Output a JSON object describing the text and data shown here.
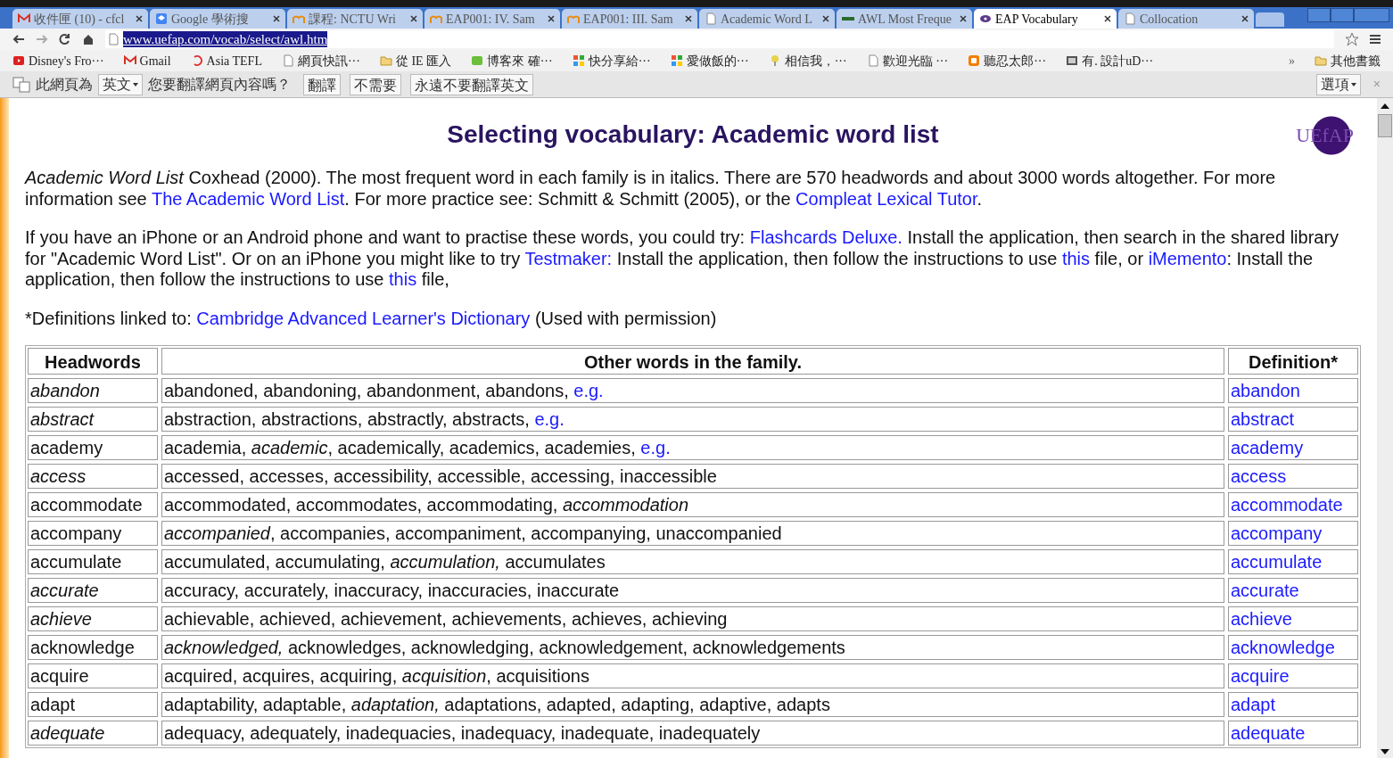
{
  "tabs": [
    {
      "title": "收件匣 (10) - cfcl",
      "kind": "gmail",
      "selected": false
    },
    {
      "title": "Google 學術搜",
      "kind": "scholar",
      "selected": false
    },
    {
      "title": "課程: NCTU Wri",
      "kind": "moodle",
      "selected": false
    },
    {
      "title": "EAP001: IV. Sam",
      "kind": "moodle",
      "selected": false
    },
    {
      "title": "EAP001: III. Sam",
      "kind": "moodle",
      "selected": false
    },
    {
      "title": "Academic Word L",
      "kind": "page",
      "selected": false
    },
    {
      "title": "AWL Most Freque",
      "kind": "dots",
      "selected": false
    },
    {
      "title": "EAP Vocabulary",
      "kind": "eye",
      "selected": true
    },
    {
      "title": "Collocation",
      "kind": "page",
      "selected": false
    }
  ],
  "address": "www.uefap.com/vocab/select/awl.htm",
  "bookmarks": [
    {
      "label": "Disney's Fro···",
      "kind": "video"
    },
    {
      "label": "Gmail",
      "kind": "gmail"
    },
    {
      "label": "Asia TEFL",
      "kind": "arc"
    },
    {
      "label": "網頁快訊···",
      "kind": "page"
    },
    {
      "label": "從 IE 匯入",
      "kind": "folder"
    },
    {
      "label": "博客來 確···",
      "kind": "message"
    },
    {
      "label": "快分享給···",
      "kind": "grid"
    },
    {
      "label": "愛做飯的···",
      "kind": "grid"
    },
    {
      "label": "相信我，···",
      "kind": "pin"
    },
    {
      "label": "歡迎光臨 ···",
      "kind": "page"
    },
    {
      "label": "聽忍太郎···",
      "kind": "blog"
    },
    {
      "label": "有. 設計uD···",
      "kind": "image"
    }
  ],
  "bookmarks_more": "»",
  "other_bookmarks": "其他書籤",
  "translate_bar": {
    "prefix": "此網頁為",
    "language": "英文",
    "question": "您要翻譯網頁內容嗎？",
    "buttons": [
      "翻譯",
      "不需要",
      "永遠不要翻譯英文"
    ],
    "options": "選項",
    "close": "×"
  },
  "page": {
    "title": "Selecting vocabulary: Academic word list",
    "logo": "UEfAP",
    "paragraphs": [
      [
        {
          "kind": "text",
          "text": "*Academic Word List* Coxhead (2000). The most frequent word in each family is in italics. There are 570 headwords and about 3000 words altogether. For more information see "
        },
        {
          "kind": "link",
          "text": "The Academic Word List"
        },
        {
          "kind": "text",
          "text": ". For more practice see: Schmitt & Schmitt (2005), or the "
        },
        {
          "kind": "link",
          "text": "Compleat Lexical Tutor"
        },
        {
          "kind": "text",
          "text": "."
        }
      ],
      [
        {
          "kind": "text",
          "text": "If you have an iPhone or an Android phone and want to practise these words, you could try: "
        },
        {
          "kind": "link",
          "text": "Flashcards Deluxe."
        },
        {
          "kind": "text",
          "text": " Install the application, then search in the shared library for \"Academic Word List\". Or on an iPhone you might like to try "
        },
        {
          "kind": "link",
          "text": "Testmaker:"
        },
        {
          "kind": "text",
          "text": " Install the application, then follow the instructions to use "
        },
        {
          "kind": "link",
          "text": "this"
        },
        {
          "kind": "text",
          "text": " file, or "
        },
        {
          "kind": "link",
          "text": "iMemento"
        },
        {
          "kind": "text",
          "text": ": Install the application, then follow the instructions to use "
        },
        {
          "kind": "link",
          "text": "this"
        },
        {
          "kind": "text",
          "text": " file,"
        }
      ],
      [
        {
          "kind": "text",
          "text": "*Definitions linked to: "
        },
        {
          "kind": "link",
          "text": "Cambridge Advanced Learner's Dictionary"
        },
        {
          "kind": "text",
          "text": " (Used with permission)"
        }
      ]
    ],
    "table": {
      "columns": [
        "Headwords",
        "Other words in the family.",
        "Definition*"
      ],
      "rows": [
        {
          "headword": "abandon",
          "italic": true,
          "other_words": [
            {
              "kind": "text",
              "text": "abandoned, abandoning, abandonment, abandons,"
            },
            {
              "kind": "link",
              "text": "e.g."
            }
          ],
          "definition": "abandon"
        },
        {
          "headword": "abstract",
          "italic": true,
          "other_words": [
            {
              "kind": "text",
              "text": "abstraction, abstractions, abstractly, abstracts,"
            },
            {
              "kind": "link",
              "text": "e.g."
            }
          ],
          "definition": "abstract"
        },
        {
          "headword": "academy",
          "italic": false,
          "other_words": [
            {
              "kind": "text",
              "text": "academia, *academic*, academically, academics, academies,"
            },
            {
              "kind": "link",
              "text": "e.g."
            }
          ],
          "definition": "academy"
        },
        {
          "headword": "access",
          "italic": true,
          "other_words": [
            {
              "kind": "text",
              "text": "accessed, accesses, accessibility, accessible, accessing, inaccessible"
            }
          ],
          "definition": "access"
        },
        {
          "headword": "accommodate",
          "italic": false,
          "other_words": [
            {
              "kind": "text",
              "text": "accommodated, accommodates, accommodating, *accommodation*"
            }
          ],
          "definition": "accommodate"
        },
        {
          "headword": "accompany",
          "italic": false,
          "other_words": [
            {
              "kind": "text",
              "text": "*accompanied*, accompanies, accompaniment, accompanying, unaccompanied"
            }
          ],
          "definition": "accompany"
        },
        {
          "headword": "accumulate",
          "italic": false,
          "other_words": [
            {
              "kind": "text",
              "text": "accumulated, accumulating, *accumulation,* accumulates"
            }
          ],
          "definition": "accumulate"
        },
        {
          "headword": "accurate",
          "italic": true,
          "other_words": [
            {
              "kind": "text",
              "text": "accuracy, accurately, inaccuracy, inaccuracies, inaccurate"
            }
          ],
          "definition": "accurate"
        },
        {
          "headword": "achieve",
          "italic": true,
          "other_words": [
            {
              "kind": "text",
              "text": "achievable, achieved, achievement, achievements, achieves, achieving"
            }
          ],
          "definition": "achieve"
        },
        {
          "headword": "acknowledge",
          "italic": false,
          "other_words": [
            {
              "kind": "text",
              "text": "*acknowledged,* acknowledges, acknowledging, acknowledgement, acknowledgements"
            }
          ],
          "definition": "acknowledge"
        },
        {
          "headword": "acquire",
          "italic": false,
          "other_words": [
            {
              "kind": "text",
              "text": "acquired, acquires, acquiring, *acquisition*, acquisitions"
            }
          ],
          "definition": "acquire"
        },
        {
          "headword": "adapt",
          "italic": false,
          "other_words": [
            {
              "kind": "text",
              "text": "adaptability, adaptable, *adaptation,* adaptations, adapted, adapting, adaptive, adapts"
            }
          ],
          "definition": "adapt"
        },
        {
          "headword": "adequate",
          "italic": true,
          "other_words": [
            {
              "kind": "text",
              "text": "adequacy, adequately, inadequacies, inadequacy, inadequate, inadequately"
            }
          ],
          "definition": "adequate"
        }
      ]
    }
  }
}
